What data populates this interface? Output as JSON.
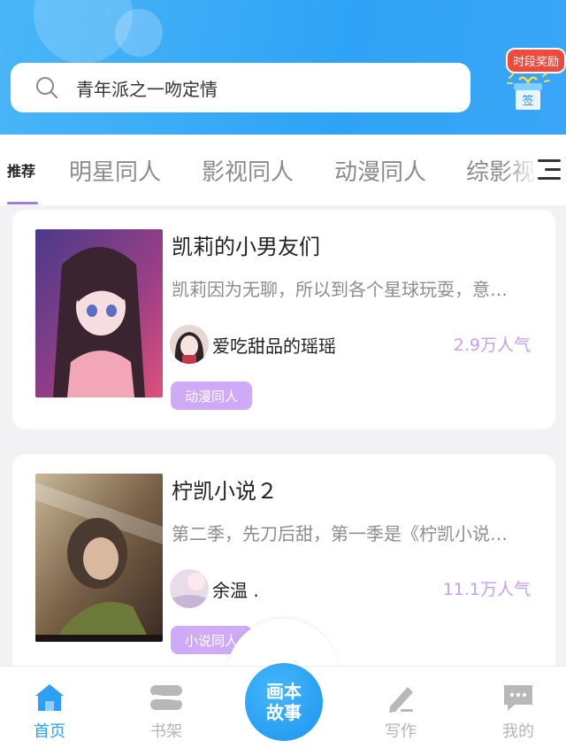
{
  "search": {
    "placeholder_text": "青年派之一吻定情"
  },
  "reward": {
    "badge": "时段奖励",
    "gift_label": "签"
  },
  "tabs": [
    {
      "label": "推荐",
      "active": true
    },
    {
      "label": "明星同人",
      "active": false
    },
    {
      "label": "影视同人",
      "active": false
    },
    {
      "label": "动漫同人",
      "active": false
    },
    {
      "label": "综影视",
      "active": false
    }
  ],
  "stories": [
    {
      "title": "凯莉的小男友们",
      "description": "凯莉因为无聊，所以到各个星球玩耍，意…",
      "author": "爱吃甜品的瑶瑶",
      "popularity": "2.9万人气",
      "tag": "动漫同人"
    },
    {
      "title": "柠凯小说２",
      "description": "第二季，先刀后甜，第一季是《柠凯小说…",
      "author": "余温 .",
      "popularity": "11.1万人气",
      "tag": "小说同人"
    }
  ],
  "bottom_nav": {
    "home": "首页",
    "bookshelf": "书架",
    "center_line1": "画本",
    "center_line2": "故事",
    "write": "写作",
    "mine": "我的"
  },
  "colors": {
    "header_blue": "#2fa3f6",
    "accent_purple": "#a77ae8",
    "tag_purple": "#cfaaf6",
    "popularity": "#c89ff0",
    "nav_active": "#2da0f4"
  }
}
